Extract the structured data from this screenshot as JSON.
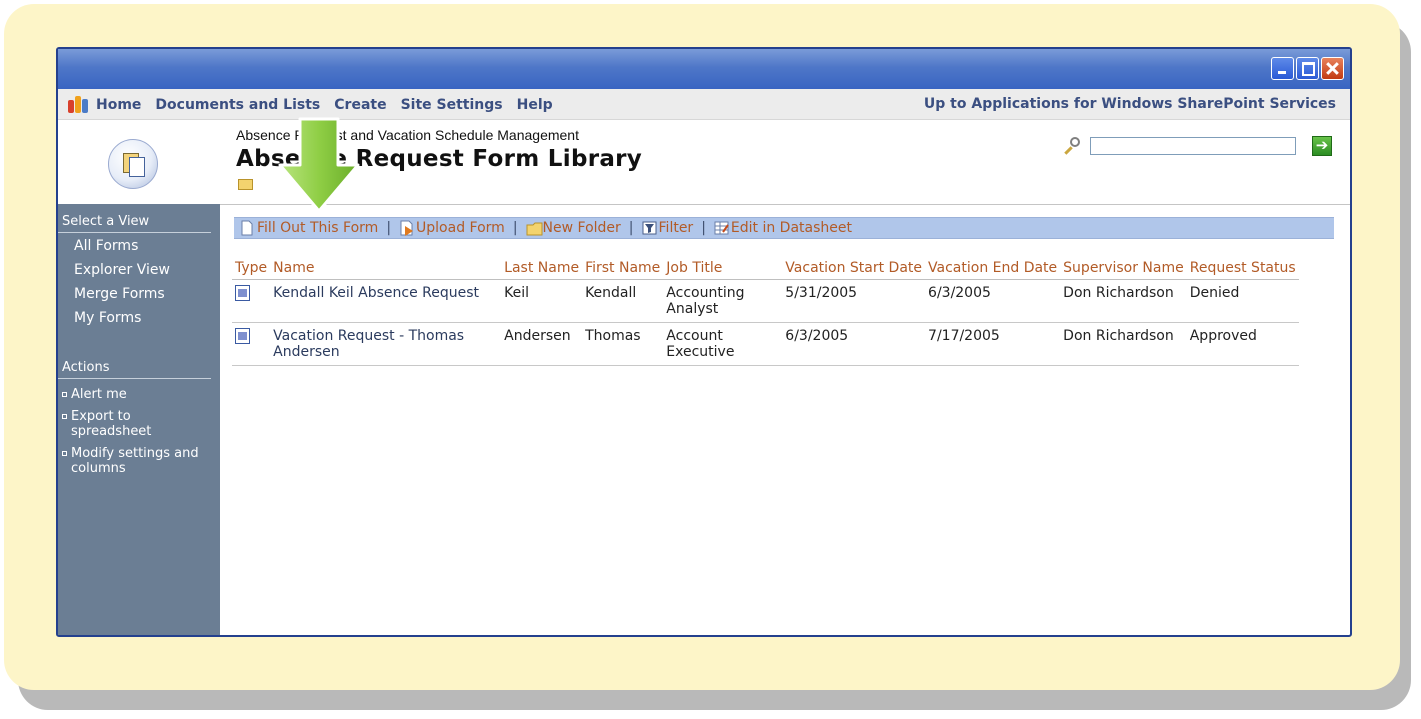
{
  "colors": {
    "frame_bg": "#fdf5c8",
    "titlebar": "#3964c2",
    "navbar_text": "#3b4f81",
    "sidebar_bg": "#6b7e94",
    "toolbar_bg": "#b0c6ea",
    "link_orange": "#b25b27",
    "arrow_green": "#8fce45"
  },
  "window": {
    "controls": [
      "minimize",
      "maximize",
      "close"
    ]
  },
  "navbar": {
    "items": [
      {
        "label": "Home",
        "icon": "sharepoint-logo-icon"
      },
      {
        "label": "Documents and Lists"
      },
      {
        "label": "Create"
      },
      {
        "label": "Site Settings"
      },
      {
        "label": "Help"
      }
    ],
    "right_link": "Up to Applications for Windows SharePoint Services"
  },
  "header": {
    "site_name": "Absence Request and Vacation Schedule Management",
    "page_title": "Absence Request Form Library",
    "search": {
      "value": "",
      "go_icon": "go-arrow-icon"
    }
  },
  "sidebar": {
    "views_heading": "Select a View",
    "views": [
      "All Forms",
      "Explorer View",
      "Merge Forms",
      "My Forms"
    ],
    "actions_heading": "Actions",
    "actions": [
      "Alert me",
      "Export to spreadsheet",
      "Modify settings and columns"
    ]
  },
  "toolbar": {
    "items": [
      {
        "label": "Fill Out This Form",
        "icon": "new-form-icon"
      },
      {
        "label": "Upload Form",
        "icon": "upload-icon"
      },
      {
        "label": "New Folder",
        "icon": "new-folder-icon"
      },
      {
        "label": "Filter",
        "icon": "filter-icon"
      },
      {
        "label": "Edit in Datasheet",
        "icon": "datasheet-icon"
      }
    ],
    "separator": "|"
  },
  "table": {
    "columns": [
      "Type",
      "Name",
      "Last Name",
      "First Name",
      "Job Title",
      "Vacation Start Date",
      "Vacation End Date",
      "Supervisor Name",
      "Request Status"
    ],
    "rows": [
      {
        "type_icon": "infopath-form-icon",
        "name": "Kendall Keil Absence Request",
        "last_name": "Keil",
        "first_name": "Kendall",
        "job_title": "Accounting Analyst",
        "start": "5/31/2005",
        "end": "6/3/2005",
        "supervisor": "Don Richardson",
        "status": "Denied"
      },
      {
        "type_icon": "infopath-form-icon",
        "name": "Vacation Request - Thomas Andersen",
        "last_name": "Andersen",
        "first_name": "Thomas",
        "job_title": "Account Executive",
        "start": "6/3/2005",
        "end": "7/17/2005",
        "supervisor": "Don Richardson",
        "status": "Approved"
      }
    ]
  },
  "callout": {
    "icon": "down-arrow-callout-icon"
  }
}
